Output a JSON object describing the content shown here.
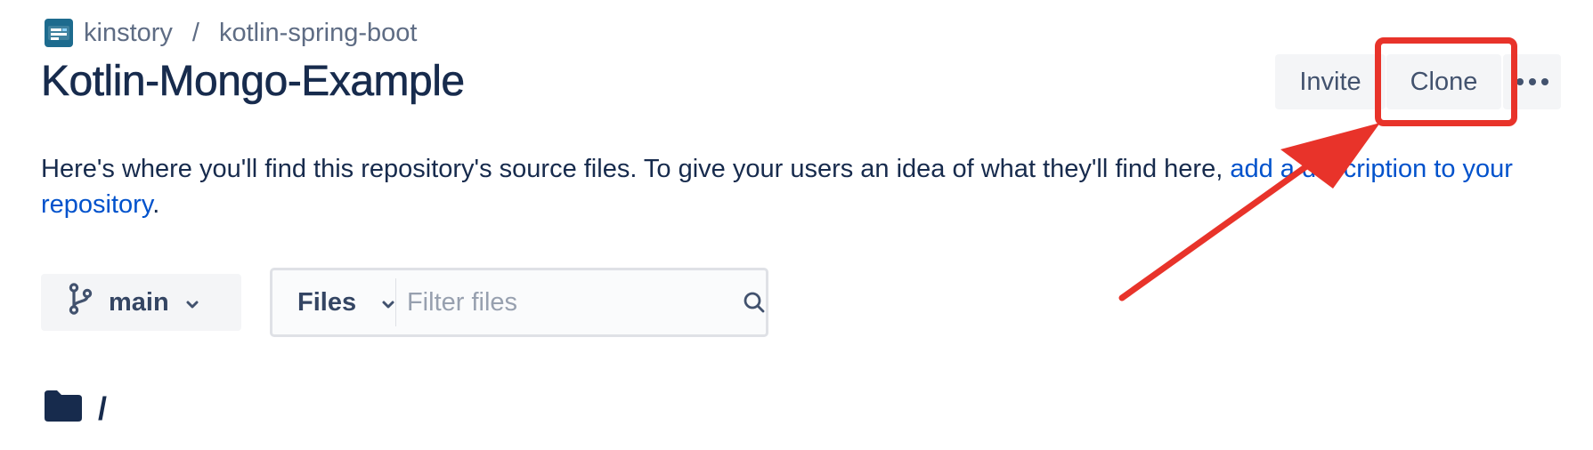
{
  "breadcrumb": {
    "workspace": "kinstory",
    "separator": "/",
    "project": "kotlin-spring-boot"
  },
  "page_title": "Kotlin-Mongo-Example",
  "actions": {
    "invite_label": "Invite",
    "clone_label": "Clone",
    "more_icon": "more-horizontal-icon"
  },
  "description": {
    "text": "Here's where you'll find this repository's source files. To give your users an idea of what they'll find here, ",
    "link_text": "add a description to your repository",
    "trailing": "."
  },
  "branch_selector": {
    "icon": "branch-icon",
    "value": "main"
  },
  "file_filter": {
    "scope_label": "Files",
    "placeholder": "Filter files",
    "value": ""
  },
  "folder": {
    "icon": "folder-icon",
    "path": "/"
  },
  "colors": {
    "link": "#0052cc",
    "annotation": "#e8332a",
    "button_bg": "#f4f5f7"
  }
}
